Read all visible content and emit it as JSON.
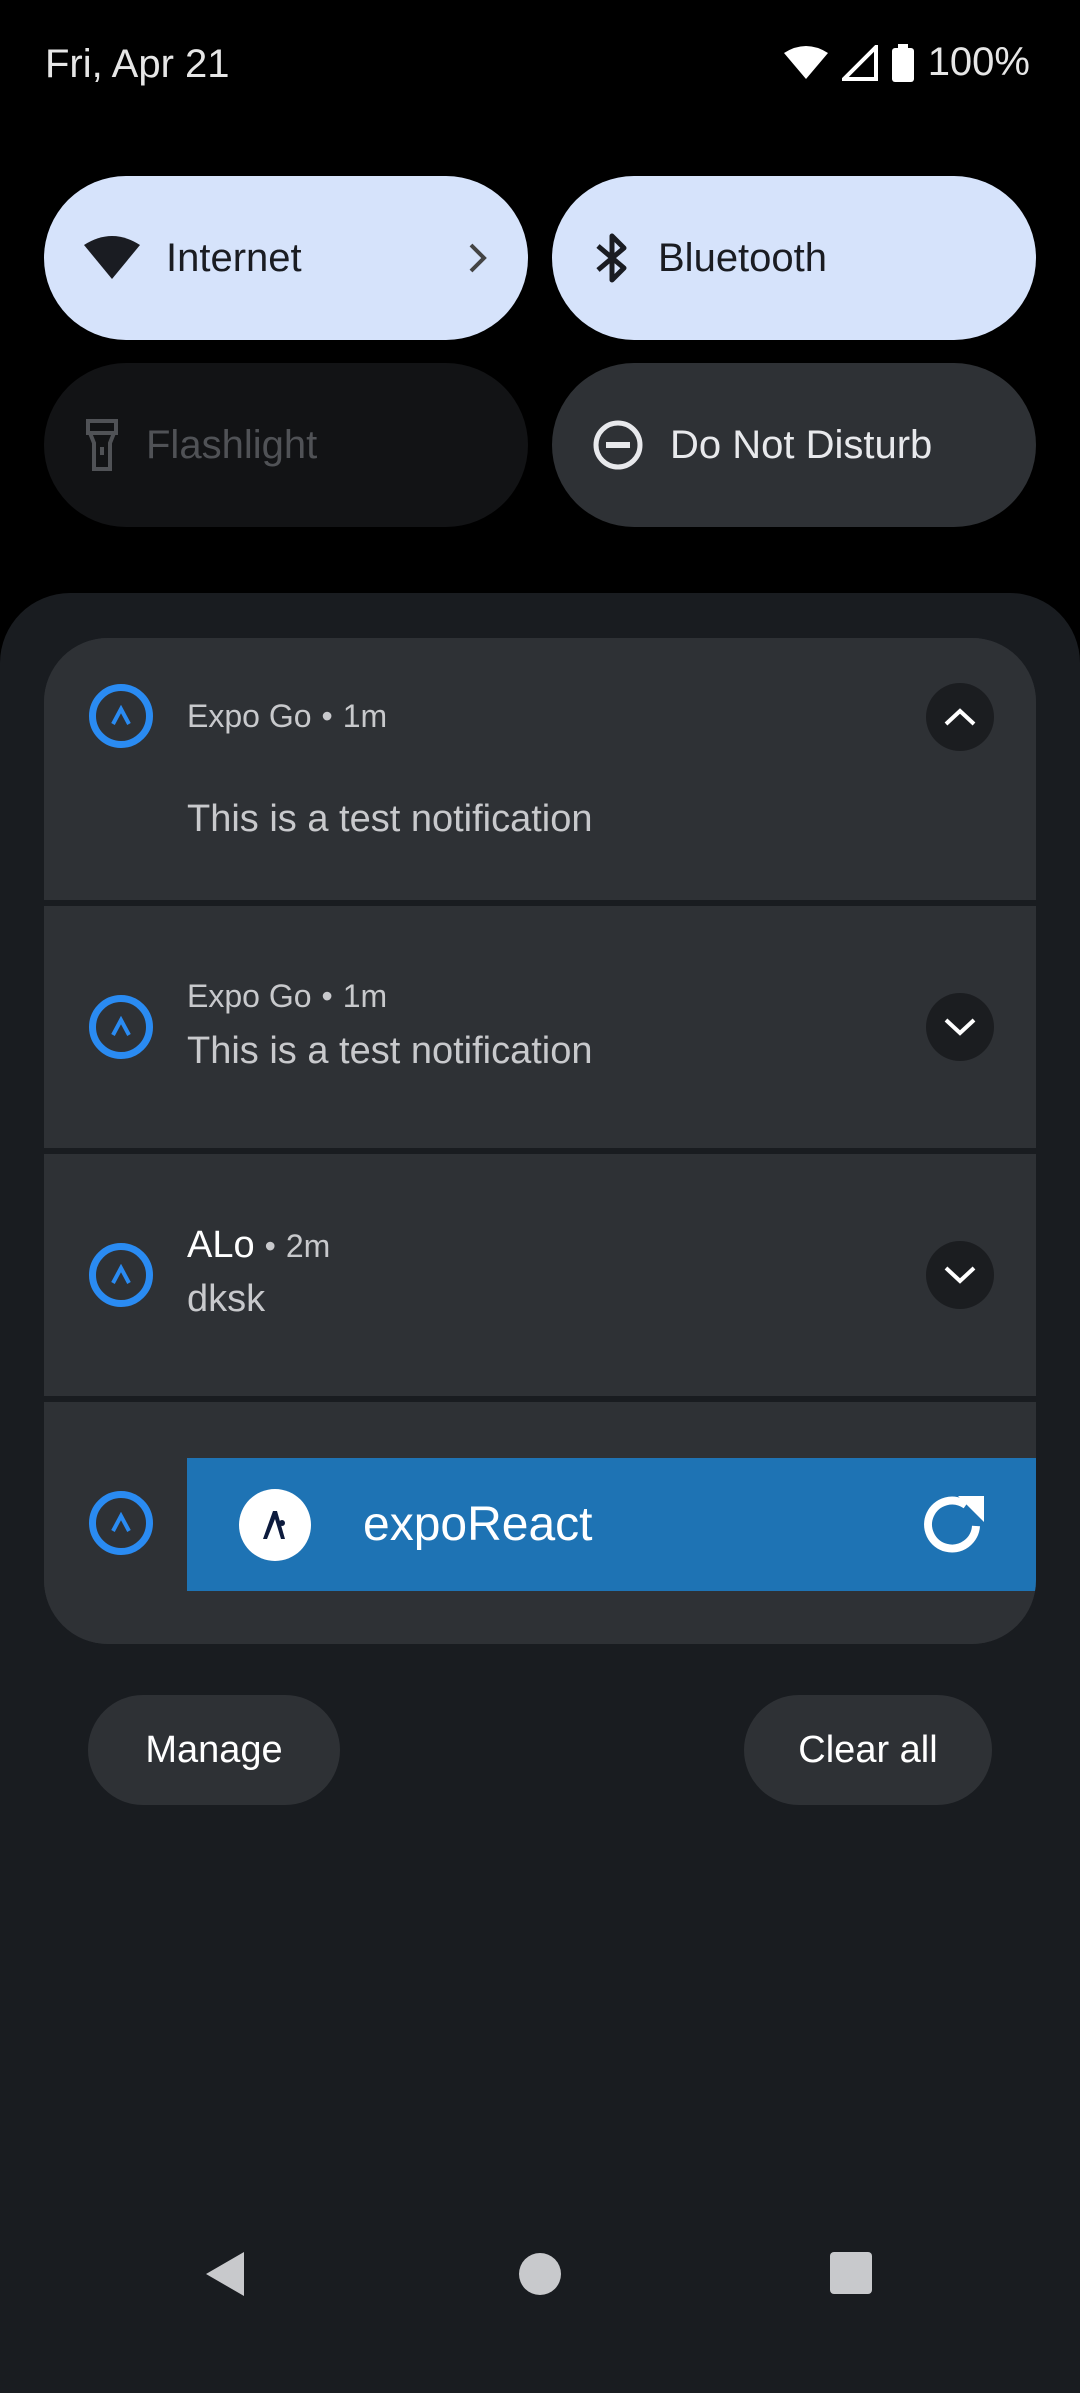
{
  "status_bar": {
    "date": "Fri, Apr 21",
    "battery_percent": "100%",
    "icons": [
      "wifi-icon",
      "cell-signal-icon",
      "battery-icon"
    ]
  },
  "quick_tiles": [
    {
      "label": "Internet",
      "icon": "wifi-icon",
      "state": "on",
      "has_chevron": true
    },
    {
      "label": "Bluetooth",
      "icon": "bluetooth-icon",
      "state": "on"
    },
    {
      "label": "Flashlight",
      "icon": "flashlight-icon",
      "state": "unavailable"
    },
    {
      "label": "Do Not Disturb",
      "icon": "do-not-disturb-icon",
      "state": "off"
    }
  ],
  "notifications": [
    {
      "app": "Expo Go",
      "time": "1m",
      "text": "This is a test notification",
      "expanded": true
    },
    {
      "app": "Expo Go",
      "time": "1m",
      "text": "This is a test notification",
      "expanded": false
    },
    {
      "app": "ALo",
      "time": "2m",
      "text": "dksk",
      "expanded": false
    }
  ],
  "media": {
    "title": "expoReact",
    "icon": "refresh-icon"
  },
  "actions": {
    "manage_label": "Manage",
    "clear_all_label": "Clear all"
  },
  "colors": {
    "tile_on": "#d6e3fb",
    "accent_blue": "#2a8bf2",
    "media_bar": "#1e73b4",
    "shade_bg": "#191c20",
    "card_bg": "#2e3135"
  }
}
